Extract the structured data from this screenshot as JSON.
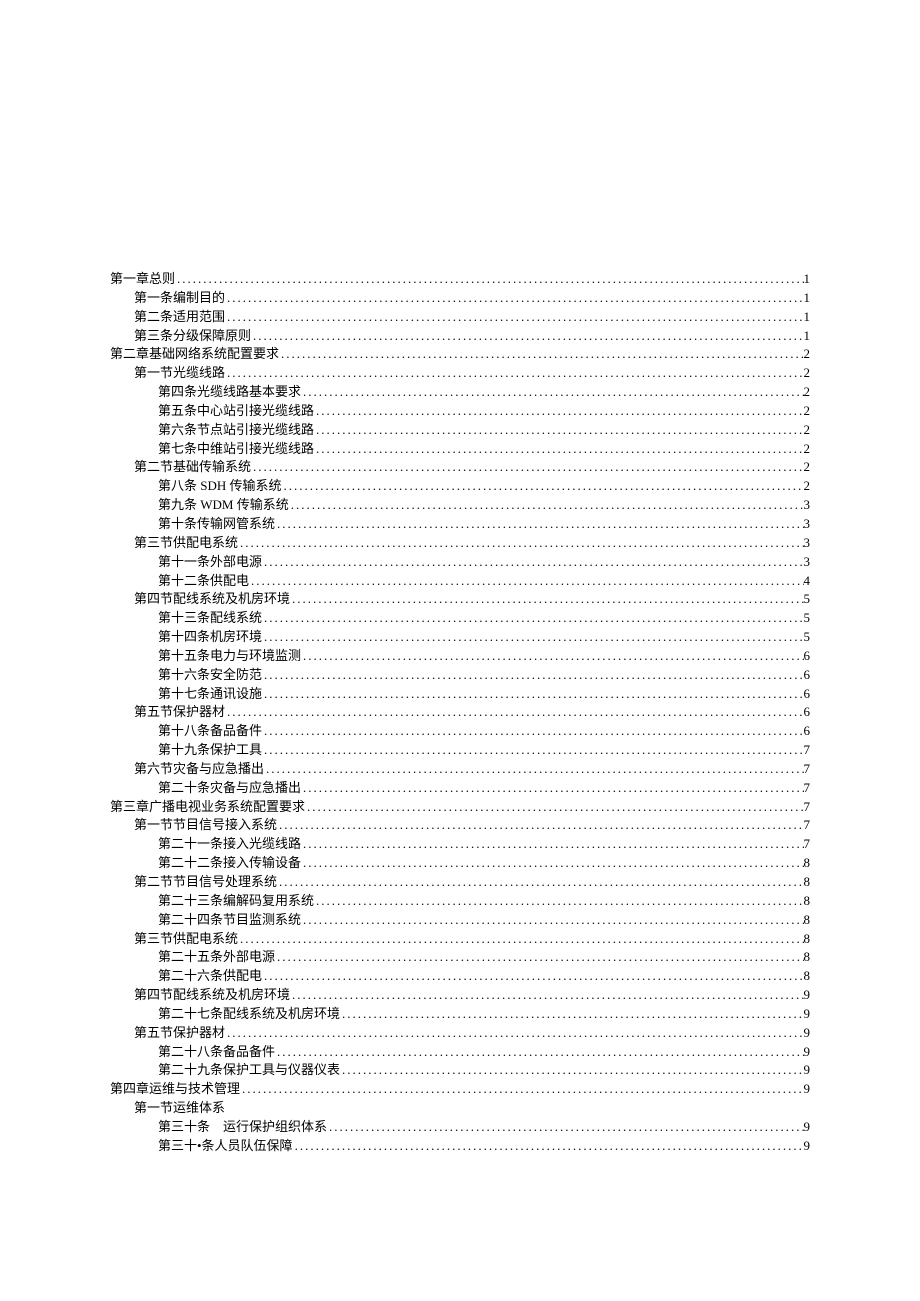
{
  "toc": [
    {
      "level": 0,
      "title": "第一章总则",
      "page": "1"
    },
    {
      "level": 1,
      "title": "第一条编制目的",
      "page": "1"
    },
    {
      "level": 1,
      "title": "第二条适用范围",
      "page": "1"
    },
    {
      "level": 1,
      "title": "第三条分级保障原则",
      "page": "1"
    },
    {
      "level": 0,
      "title": "第二章基础网络系统配置要求",
      "page": "2"
    },
    {
      "level": 1,
      "title": "第一节光缆线路",
      "page": "2"
    },
    {
      "level": 2,
      "title": "第四条光缆线路基本要求",
      "page": "2"
    },
    {
      "level": 2,
      "title": "第五条中心站引接光缆线路",
      "page": "2"
    },
    {
      "level": 2,
      "title": "第六条节点站引接光缆线路",
      "page": "2"
    },
    {
      "level": 2,
      "title": "第七条中维站引接光缆线路",
      "page": "2"
    },
    {
      "level": 1,
      "title": "第二节基础传输系统",
      "page": "2"
    },
    {
      "level": 2,
      "title": "第八条 SDH 传输系统",
      "page": "2"
    },
    {
      "level": 2,
      "title": "第九条 WDM 传输系统",
      "page": "3"
    },
    {
      "level": 2,
      "title": "第十条传输网管系统",
      "page": "3"
    },
    {
      "level": 1,
      "title": "第三节供配电系统",
      "page": "3"
    },
    {
      "level": 2,
      "title": "第十一条外部电源",
      "page": "3"
    },
    {
      "level": 2,
      "title": "第十二条供配电",
      "page": "4"
    },
    {
      "level": 1,
      "title": "第四节配线系统及机房环境",
      "page": "5"
    },
    {
      "level": 2,
      "title": "第十三条配线系统",
      "page": "5"
    },
    {
      "level": 2,
      "title": "第十四条机房环境",
      "page": "5"
    },
    {
      "level": 2,
      "title": "第十五条电力与环境监测",
      "page": "6"
    },
    {
      "level": 2,
      "title": "第十六条安全防范",
      "page": "6"
    },
    {
      "level": 2,
      "title": "第十七条通讯设施",
      "page": "6"
    },
    {
      "level": 1,
      "title": "第五节保护器材",
      "page": "6"
    },
    {
      "level": 2,
      "title": "第十八条备品备件",
      "page": "6"
    },
    {
      "level": 2,
      "title": "第十九条保护工具",
      "page": "7"
    },
    {
      "level": 1,
      "title": "第六节灾备与应急播出",
      "page": "7"
    },
    {
      "level": 2,
      "title": "第二十条灾备与应急播出",
      "page": "7"
    },
    {
      "level": 0,
      "title": "第三章广播电视业务系统配置要求",
      "page": "7"
    },
    {
      "level": 1,
      "title": "第一节节目信号接入系统",
      "page": "7"
    },
    {
      "level": 2,
      "title": "第二十一条接入光缆线路",
      "page": "7"
    },
    {
      "level": 2,
      "title": "第二十二条接入传输设备",
      "page": "8"
    },
    {
      "level": 1,
      "title": "第二节节目信号处理系统",
      "page": "8"
    },
    {
      "level": 2,
      "title": "第二十三条编解码复用系统",
      "page": "8"
    },
    {
      "level": 2,
      "title": "第二十四条节目监测系统",
      "page": "8"
    },
    {
      "level": 1,
      "title": "第三节供配电系统",
      "page": "8"
    },
    {
      "level": 2,
      "title": "第二十五条外部电源",
      "page": "8"
    },
    {
      "level": 2,
      "title": "第二十六条供配电",
      "page": "8"
    },
    {
      "level": 1,
      "title": "第四节配线系统及机房环境",
      "page": "9"
    },
    {
      "level": 2,
      "title": "第二十七条配线系统及机房环境",
      "page": "9"
    },
    {
      "level": 1,
      "title": "第五节保护器材",
      "page": "9"
    },
    {
      "level": 2,
      "title": "第二十八条备品备件",
      "page": "9"
    },
    {
      "level": 2,
      "title": "第二十九条保护工具与仪器仪表",
      "page": "9"
    },
    {
      "level": 0,
      "title": "第四章运维与技术管理",
      "page": "9"
    },
    {
      "level": 1,
      "title": "第一节运维体系",
      "page": "",
      "noPage": true
    },
    {
      "level": 2,
      "title": "第三十条　运行保护组织体系",
      "page": "9"
    },
    {
      "level": 2,
      "title": "第三十•条人员队伍保障",
      "page": "9"
    }
  ]
}
